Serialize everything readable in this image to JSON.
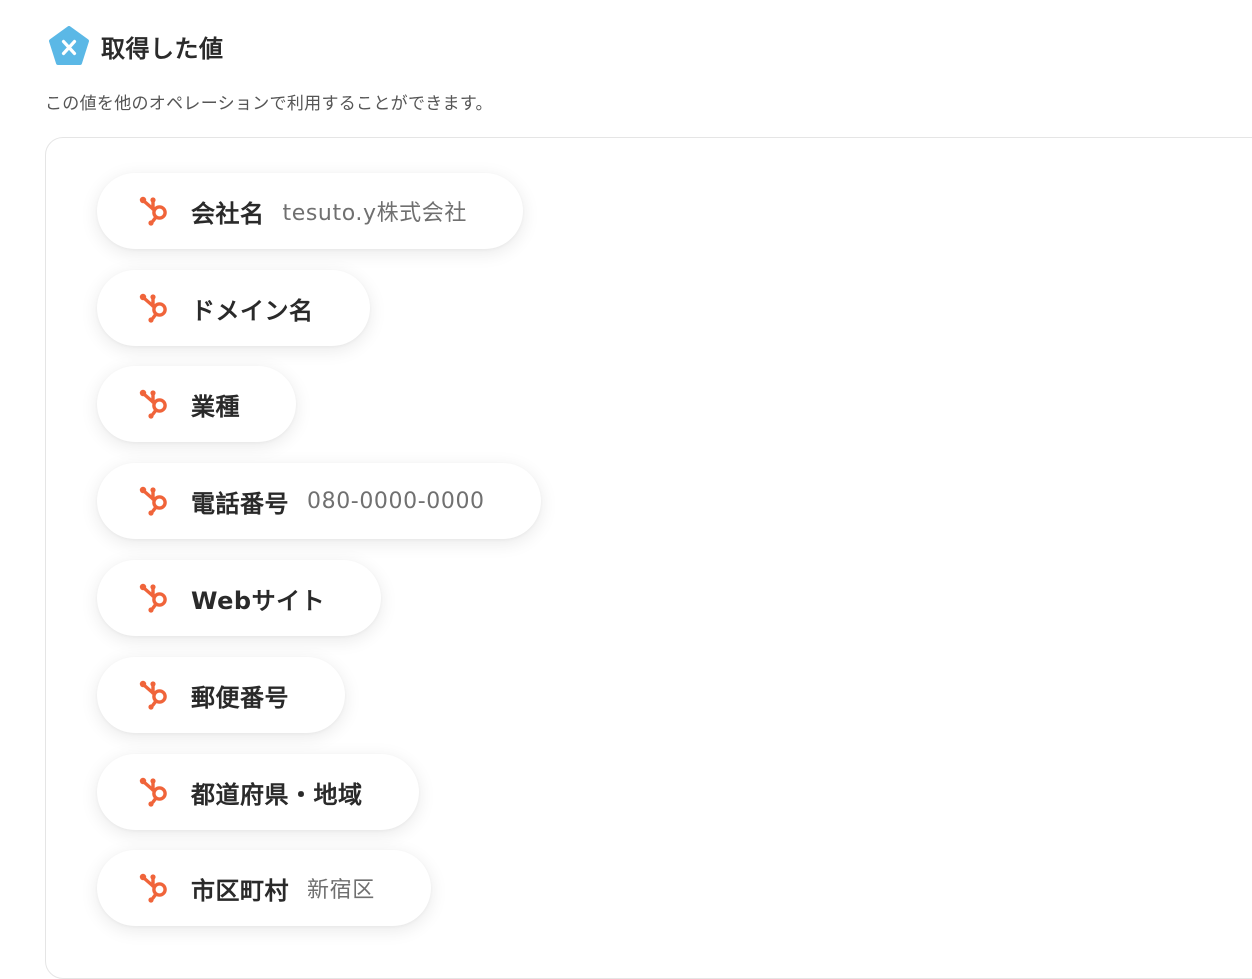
{
  "header": {
    "title": "取得した値",
    "icon": "variable-x-icon",
    "icon_color": "#5bb8e6"
  },
  "description": "この値を他のオペレーションで利用することができます。",
  "fields": [
    {
      "label": "会社名",
      "value": "tesuto.y株式会社",
      "icon": "hubspot-sprocket-icon"
    },
    {
      "label": "ドメイン名",
      "value": "",
      "icon": "hubspot-sprocket-icon"
    },
    {
      "label": "業種",
      "value": "",
      "icon": "hubspot-sprocket-icon"
    },
    {
      "label": "電話番号",
      "value": "080-0000-0000",
      "icon": "hubspot-sprocket-icon"
    },
    {
      "label": "Webサイト",
      "value": "",
      "icon": "hubspot-sprocket-icon"
    },
    {
      "label": "郵便番号",
      "value": "",
      "icon": "hubspot-sprocket-icon"
    },
    {
      "label": "都道府県・地域",
      "value": "",
      "icon": "hubspot-sprocket-icon"
    },
    {
      "label": "市区町村",
      "value": "新宿区",
      "icon": "hubspot-sprocket-icon"
    }
  ],
  "colors": {
    "hubspot_orange": "#f0643a",
    "label_text": "#2a2a2a",
    "value_text": "#707070"
  }
}
